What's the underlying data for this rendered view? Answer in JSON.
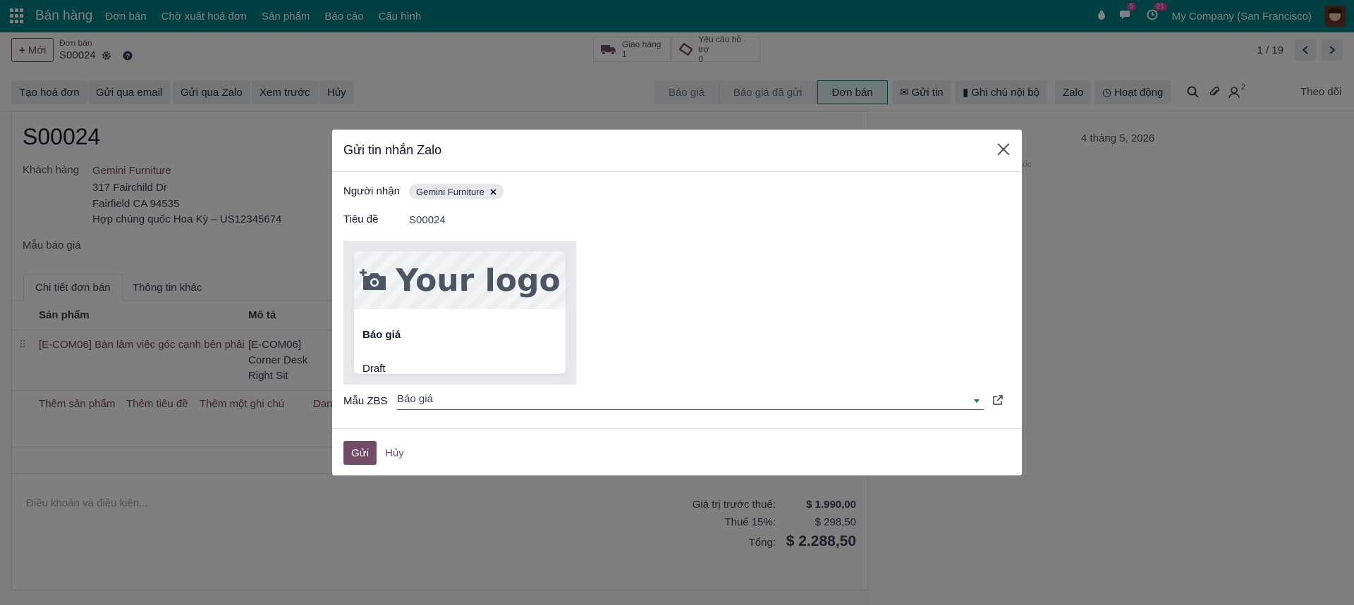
{
  "navbar": {
    "brand": "Bán hàng",
    "menu": [
      "Đơn bán",
      "Chờ xuất hoá đơn",
      "Sản phẩm",
      "Báo cáo",
      "Cấu hình"
    ],
    "messages_count": "5",
    "activities_count": "21",
    "company": "My Company (San Francisco)"
  },
  "control": {
    "new_label": "Mới",
    "breadcrumb_parent": "Đơn bán",
    "breadcrumb_current": "S00024",
    "smart_delivery": {
      "label": "Giao hàng",
      "count": "1"
    },
    "smart_support": {
      "label": "Yêu cầu hỗ trợ",
      "count": "0"
    },
    "pager": "1 / 19"
  },
  "actions": [
    "Tạo hoá đơn",
    "Gửi qua email",
    "Gửi qua Zalo",
    "Xem trước",
    "Hủy"
  ],
  "statusbar": [
    "Báo giá",
    "Báo giá đã gửi",
    "Đơn bán"
  ],
  "chatter": {
    "send_message": "Gửi tin",
    "log_note": "Ghi chú nội bộ",
    "zalo": "Zalo",
    "activities": "Hoạt động",
    "followers_count": "2",
    "follow": "Theo dõi",
    "date": "4 tháng 5, 2026",
    "frag": "ốc"
  },
  "form": {
    "name": "S00024",
    "customer_label": "Khách hàng",
    "customer_name": "Gemini Furniture",
    "address1": "317 Fairchild Dr",
    "address2": "Fairfield CA 94535",
    "address3": "Hợp chúng quốc Hoa Kỳ – US12345674",
    "template_label": "Mẫu báo giá",
    "tabs": [
      "Chi tiết đơn bán",
      "Thông tin khác"
    ],
    "columns": {
      "product": "Sản phẩm",
      "description": "Mô tả"
    },
    "line": {
      "product": "[E-COM06] Bàn làm việc góc cạnh bên phải",
      "desc1": "[E-COM06]",
      "desc2": "Corner Desk",
      "desc3": "Right Sit"
    },
    "add_product": "Thêm sản phẩm",
    "add_section": "Thêm tiêu đề",
    "add_note": "Thêm một ghi chú",
    "add_frag": "Dan",
    "terms_placeholder": "Điều khoản và điều kiện...",
    "untaxed_label": "Giá trị trước thuế:",
    "untaxed_value": "$ 1.990,00",
    "tax_label": "Thuế 15%:",
    "tax_value": "$ 298,50",
    "total_label": "Tổng:",
    "total_value": "$ 2.288,50"
  },
  "dialog": {
    "title": "Gửi tin nhắn Zalo",
    "recipient_label": "Người nhận",
    "recipient_tag": "Gemini Furniture",
    "subject_label": "Tiêu đề",
    "subject_value": "S00024",
    "logo_text": "Your logo",
    "card_title": "Báo giá",
    "card_sub": "Draft",
    "template_label": "Mẫu ZBS",
    "template_value": "Báo giá",
    "send": "Gửi",
    "cancel": "Hủy"
  }
}
